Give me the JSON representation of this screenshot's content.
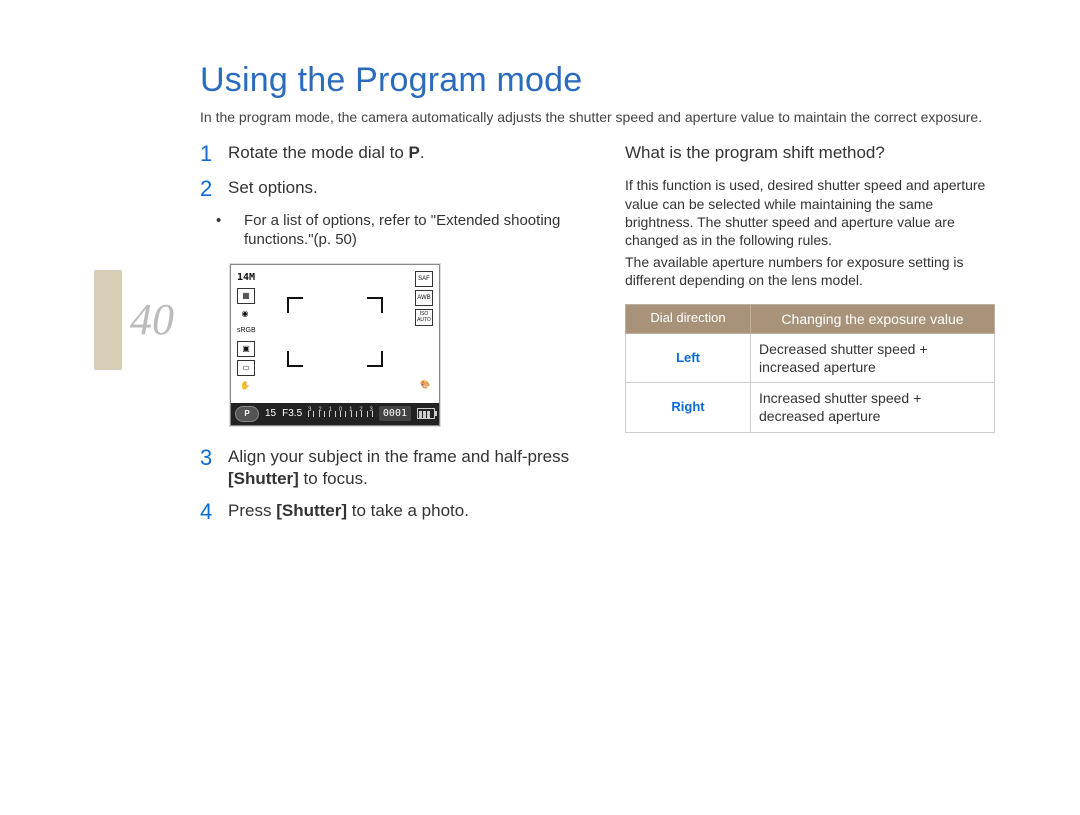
{
  "page_number": "40",
  "title": "Using the Program mode",
  "intro": "In the program mode, the camera automatically adjusts the shutter speed and aperture value to maintain the correct exposure.",
  "steps": {
    "s1_pre": "Rotate the mode dial to ",
    "s1_bold": "P",
    "s1_post": ".",
    "s2": "Set options.",
    "s2_note": "For a list of options, refer to \"Extended shooting functions.\"(p. 50)",
    "s3_pre": "Align your subject in the frame and half-press ",
    "s3_bold": "[Shutter]",
    "s3_post": " to focus.",
    "s4_pre": "Press ",
    "s4_bold": "[Shutter]",
    "s4_post": " to take a photo."
  },
  "lcd": {
    "size_label": "14M",
    "mode_icon": "P",
    "shutter": "15",
    "aperture": "F3.5",
    "counter": "0001",
    "ev_labels": [
      "3",
      "2",
      "1",
      "0",
      "1",
      "2",
      "3"
    ],
    "right": {
      "saf": "SAF",
      "awb": "AWB",
      "iso": "ISO\nAUTO"
    }
  },
  "right_col": {
    "heading": "What is the program shift method?",
    "p1": "If this function is used, desired shutter speed and aperture value can be selected while maintaining the same brightness. The shutter speed and aperture value are changed as in the following rules.",
    "p2": "The available aperture numbers for exposure setting is different depending on the lens model."
  },
  "chart_data": {
    "type": "table",
    "headers": [
      "Dial direction",
      "Changing the exposure value"
    ],
    "rows": [
      {
        "dir": "Left",
        "val": "Decreased shutter speed + increased aperture"
      },
      {
        "dir": "Right",
        "val": "Increased shutter speed + decreased aperture"
      }
    ]
  }
}
